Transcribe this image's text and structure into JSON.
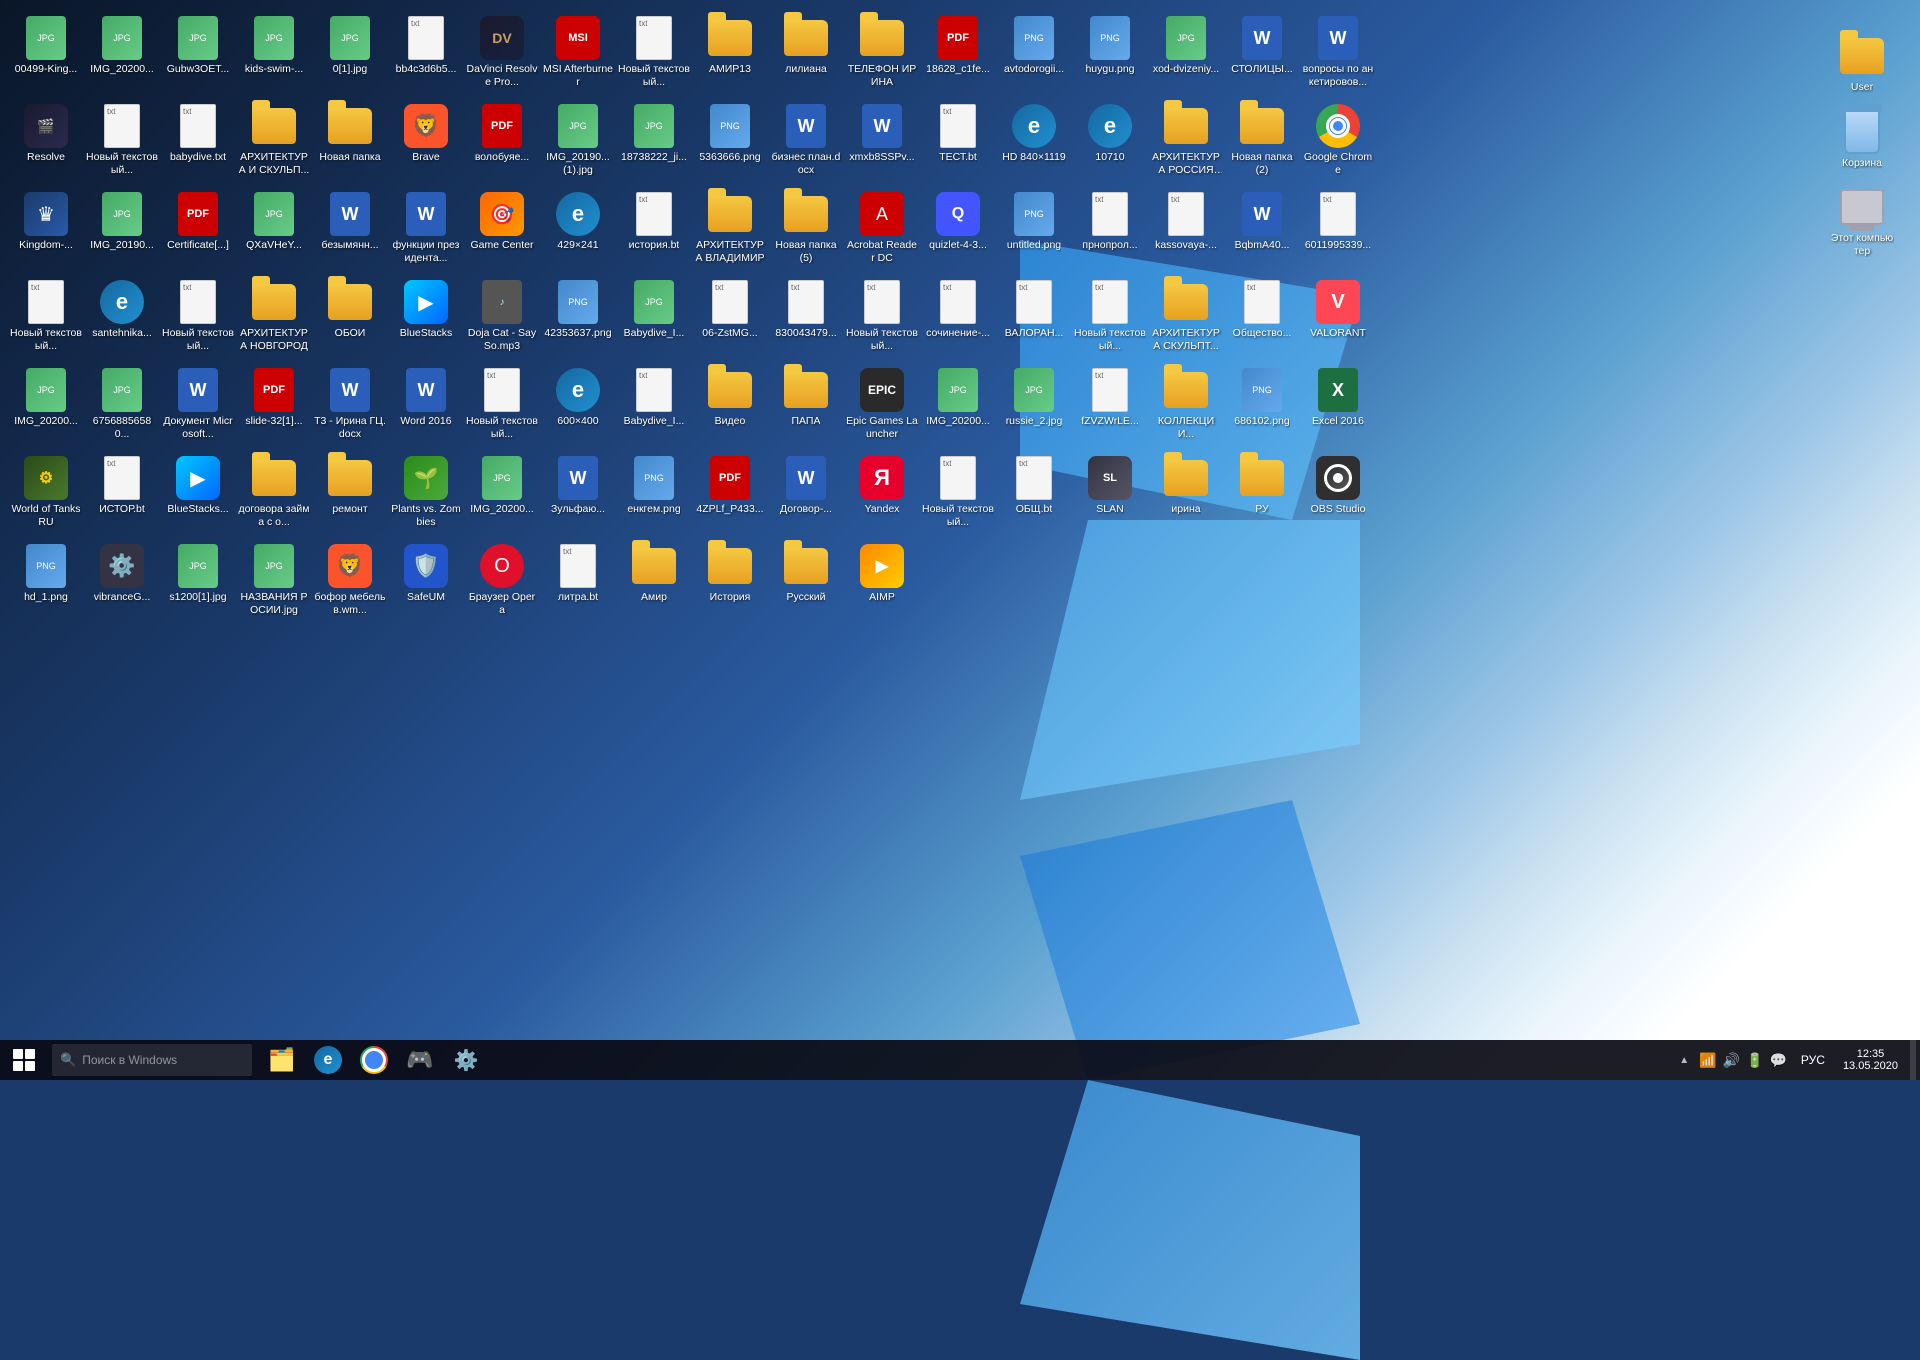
{
  "desktop": {
    "title": "Windows 10 Desktop",
    "icons": [
      {
        "id": "i1",
        "label": "00499-King...",
        "type": "jpg",
        "row": 1,
        "col": 1
      },
      {
        "id": "i2",
        "label": "IMG_20200...",
        "type": "jpg",
        "row": 1,
        "col": 2
      },
      {
        "id": "i3",
        "label": "Gubw3OET...",
        "type": "jpg",
        "row": 1,
        "col": 3
      },
      {
        "id": "i4",
        "label": "kids-swim-...",
        "type": "jpg",
        "row": 1,
        "col": 4
      },
      {
        "id": "i5",
        "label": "0[1].jpg",
        "type": "jpg",
        "row": 1,
        "col": 5
      },
      {
        "id": "i6",
        "label": "bb4c3d6b5...",
        "type": "txt",
        "row": 1,
        "col": 6
      },
      {
        "id": "i7",
        "label": "DaVinci Resolve Pro...",
        "type": "app-davinci",
        "row": 1,
        "col": 7
      },
      {
        "id": "i8",
        "label": "MSI Afterburner",
        "type": "app-msi",
        "row": 1,
        "col": 8
      },
      {
        "id": "i9",
        "label": "Новый текстовый...",
        "type": "txt",
        "row": 1,
        "col": 9
      },
      {
        "id": "i10",
        "label": "АМИР13",
        "type": "folder",
        "row": 1,
        "col": 10
      },
      {
        "id": "i11",
        "label": "лилиана",
        "type": "folder",
        "row": 1,
        "col": 11
      },
      {
        "id": "i12",
        "label": "ТЕЛЕФОН ИРИНА",
        "type": "folder",
        "row": 1,
        "col": 12
      },
      {
        "id": "i13",
        "label": "18628_c1fe...",
        "type": "pdf",
        "row": 2,
        "col": 1
      },
      {
        "id": "i14",
        "label": "avtodorogii...",
        "type": "png",
        "row": 2,
        "col": 2
      },
      {
        "id": "i15",
        "label": "huygu.png",
        "type": "png",
        "row": 2,
        "col": 3
      },
      {
        "id": "i16",
        "label": "xod-dvizeniy...",
        "type": "jpg",
        "row": 2,
        "col": 4
      },
      {
        "id": "i17",
        "label": "СТОЛИЦЫ...",
        "type": "word",
        "row": 2,
        "col": 5
      },
      {
        "id": "i18",
        "label": "вопросы по анкетировов...",
        "type": "word",
        "row": 2,
        "col": 6
      },
      {
        "id": "i19",
        "label": "Resolve",
        "type": "app-resolve",
        "row": 2,
        "col": 7
      },
      {
        "id": "i20",
        "label": "Новый текстовый...",
        "type": "txt",
        "row": 2,
        "col": 8
      },
      {
        "id": "i21",
        "label": "babydive.txt",
        "type": "txt",
        "row": 2,
        "col": 9
      },
      {
        "id": "i22",
        "label": "АРХИТЕКТУРА И СКУЛЬП...",
        "type": "folder",
        "row": 2,
        "col": 10
      },
      {
        "id": "i23",
        "label": "Новая папка",
        "type": "folder",
        "row": 2,
        "col": 11
      },
      {
        "id": "i24",
        "label": "Brave",
        "type": "app-brave",
        "row": 2,
        "col": 12
      },
      {
        "id": "i25",
        "label": "волобуяе...",
        "type": "pdf",
        "row": 3,
        "col": 1
      },
      {
        "id": "i26",
        "label": "IMG_20190...(1).jpg",
        "type": "jpg",
        "row": 3,
        "col": 2
      },
      {
        "id": "i27",
        "label": "18738222_ji...",
        "type": "jpg",
        "row": 3,
        "col": 3
      },
      {
        "id": "i28",
        "label": "5363666.png",
        "type": "png",
        "row": 3,
        "col": 4
      },
      {
        "id": "i29",
        "label": "бизнес план.docx",
        "type": "word",
        "row": 3,
        "col": 5
      },
      {
        "id": "i30",
        "label": "xmxb8SSPv...",
        "type": "word",
        "row": 3,
        "col": 6
      },
      {
        "id": "i31",
        "label": "ТЕСТ.bt",
        "type": "txt",
        "row": 3,
        "col": 7
      },
      {
        "id": "i32",
        "label": "HD 840×1119",
        "type": "app-ie",
        "row": 3,
        "col": 8
      },
      {
        "id": "i33",
        "label": "10710",
        "type": "app-ie",
        "row": 3,
        "col": 9
      },
      {
        "id": "i34",
        "label": "АРХИТЕКТУРА РОССИЯ И...",
        "type": "folder",
        "row": 3,
        "col": 10
      },
      {
        "id": "i35",
        "label": "Новая папка (2)",
        "type": "folder",
        "row": 3,
        "col": 11
      },
      {
        "id": "i36",
        "label": "Google Chrome",
        "type": "app-chrome",
        "row": 3,
        "col": 12
      },
      {
        "id": "i37",
        "label": "Kingdom-...",
        "type": "app-kingdom",
        "row": 4,
        "col": 1
      },
      {
        "id": "i38",
        "label": "IMG_20190...",
        "type": "jpg",
        "row": 4,
        "col": 2
      },
      {
        "id": "i39",
        "label": "Certificate[...]",
        "type": "pdf",
        "row": 4,
        "col": 3
      },
      {
        "id": "i40",
        "label": "QXaVHeY...",
        "type": "jpg",
        "row": 4,
        "col": 4
      },
      {
        "id": "i41",
        "label": "безымянн...",
        "type": "word",
        "row": 4,
        "col": 5
      },
      {
        "id": "i42",
        "label": "функции президента...",
        "type": "word",
        "row": 4,
        "col": 6
      },
      {
        "id": "i43",
        "label": "Game Center",
        "type": "app-gamecenter",
        "row": 4,
        "col": 7
      },
      {
        "id": "i44",
        "label": "429×241",
        "type": "app-ie",
        "row": 4,
        "col": 8
      },
      {
        "id": "i45",
        "label": "история.bt",
        "type": "txt",
        "row": 4,
        "col": 9
      },
      {
        "id": "i46",
        "label": "АРХИТЕКТУРА ВЛАДИМИР",
        "type": "folder",
        "row": 4,
        "col": 10
      },
      {
        "id": "i47",
        "label": "Новая папка (5)",
        "type": "folder",
        "row": 4,
        "col": 11
      },
      {
        "id": "i48",
        "label": "Acrobat Reader DC",
        "type": "app-acrobat",
        "row": 4,
        "col": 12
      },
      {
        "id": "i49",
        "label": "quizlet-4-3...",
        "type": "app-quizlet",
        "row": 5,
        "col": 1
      },
      {
        "id": "i50",
        "label": "untitled.png",
        "type": "png",
        "row": 5,
        "col": 2
      },
      {
        "id": "i51",
        "label": "прнопрол...",
        "type": "txt",
        "row": 5,
        "col": 3
      },
      {
        "id": "i52",
        "label": "kassovaya-...",
        "type": "txt",
        "row": 5,
        "col": 4
      },
      {
        "id": "i53",
        "label": "BqbmA40...",
        "type": "word",
        "row": 5,
        "col": 5
      },
      {
        "id": "i54",
        "label": "6011995339...",
        "type": "txt",
        "row": 5,
        "col": 6
      },
      {
        "id": "i55",
        "label": "Новый текстовый...",
        "type": "txt",
        "row": 5,
        "col": 7
      },
      {
        "id": "i56",
        "label": "santehnika...",
        "type": "app-ie",
        "row": 5,
        "col": 8
      },
      {
        "id": "i57",
        "label": "Новый текстовый...",
        "type": "txt",
        "row": 5,
        "col": 9
      },
      {
        "id": "i58",
        "label": "АРХИТЕКТУРА НОВГОРОД",
        "type": "folder",
        "row": 5,
        "col": 10
      },
      {
        "id": "i59",
        "label": "ОБОИ",
        "type": "folder",
        "row": 5,
        "col": 11
      },
      {
        "id": "i60",
        "label": "BlueStacks",
        "type": "app-bluestacks",
        "row": 5,
        "col": 12
      },
      {
        "id": "i61",
        "label": "Doja Cat - Say So.mp3",
        "type": "mp3",
        "row": 6,
        "col": 1
      },
      {
        "id": "i62",
        "label": "42353637.png",
        "type": "png",
        "row": 6,
        "col": 2
      },
      {
        "id": "i63",
        "label": "Babydive_I...",
        "type": "jpg",
        "row": 6,
        "col": 3
      },
      {
        "id": "i64",
        "label": "06-ZstMG...",
        "type": "txt",
        "row": 6,
        "col": 4
      },
      {
        "id": "i65",
        "label": "830043479...",
        "type": "txt",
        "row": 6,
        "col": 5
      },
      {
        "id": "i66",
        "label": "Новый текстовый...",
        "type": "txt",
        "row": 6,
        "col": 6
      },
      {
        "id": "i67",
        "label": "сочинение-...",
        "type": "txt",
        "row": 6,
        "col": 7
      },
      {
        "id": "i68",
        "label": "ВАЛОРАН...",
        "type": "txt",
        "row": 6,
        "col": 8
      },
      {
        "id": "i69",
        "label": "Новый текстовый...",
        "type": "txt",
        "row": 6,
        "col": 9
      },
      {
        "id": "i70",
        "label": "АРХИТЕКТУРА СКУЛЬПТ...",
        "type": "folder",
        "row": 6,
        "col": 10
      },
      {
        "id": "i71",
        "label": "Общество...",
        "type": "txt",
        "row": 6,
        "col": 11
      },
      {
        "id": "i72",
        "label": "VALORANT",
        "type": "app-valorant",
        "row": 6,
        "col": 12
      },
      {
        "id": "i73",
        "label": "IMG_20200...",
        "type": "jpg",
        "row": 7,
        "col": 1
      },
      {
        "id": "i74",
        "label": "67568856580...",
        "type": "jpg",
        "row": 7,
        "col": 2
      },
      {
        "id": "i75",
        "label": "Документ Microsoft...",
        "type": "word",
        "row": 7,
        "col": 3
      },
      {
        "id": "i76",
        "label": "slide-32[1]...",
        "type": "pdf",
        "row": 7,
        "col": 4
      },
      {
        "id": "i77",
        "label": "Т3 - Ирина ГЦ.docx",
        "type": "word",
        "row": 7,
        "col": 5
      },
      {
        "id": "i78",
        "label": "Word 2016",
        "type": "word",
        "row": 7,
        "col": 6
      },
      {
        "id": "i79",
        "label": "Новый текстовый...",
        "type": "txt",
        "row": 7,
        "col": 7
      },
      {
        "id": "i80",
        "label": "600×400",
        "type": "app-ie",
        "row": 7,
        "col": 8
      },
      {
        "id": "i81",
        "label": "Babydive_I...",
        "type": "txt",
        "row": 7,
        "col": 9
      },
      {
        "id": "i82",
        "label": "Видео",
        "type": "folder",
        "row": 7,
        "col": 10
      },
      {
        "id": "i83",
        "label": "ПАПА",
        "type": "folder",
        "row": 7,
        "col": 11
      },
      {
        "id": "i84",
        "label": "Epic Games Launcher",
        "type": "app-epic",
        "row": 7,
        "col": 12
      },
      {
        "id": "i85",
        "label": "IMG_20200...",
        "type": "jpg",
        "row": 8,
        "col": 1
      },
      {
        "id": "i86",
        "label": "russie_2.jpg",
        "type": "jpg",
        "row": 8,
        "col": 2
      },
      {
        "id": "i87",
        "label": "fZVZWrLE...",
        "type": "txt",
        "row": 8,
        "col": 3
      },
      {
        "id": "i88",
        "label": "КОЛЛЕКЦИИ...",
        "type": "folder",
        "row": 8,
        "col": 4
      },
      {
        "id": "i89",
        "label": "686102.png",
        "type": "png",
        "row": 8,
        "col": 5
      },
      {
        "id": "i90",
        "label": "Excel 2016",
        "type": "excel",
        "row": 8,
        "col": 6
      },
      {
        "id": "i91",
        "label": "World of Tanks RU",
        "type": "app-wot",
        "row": 8,
        "col": 7
      },
      {
        "id": "i92",
        "label": "ИСТОР.bt",
        "type": "txt",
        "row": 8,
        "col": 8
      },
      {
        "id": "i93",
        "label": "BlueStacks...",
        "type": "app-bluestacks",
        "row": 8,
        "col": 9
      },
      {
        "id": "i94",
        "label": "договора займа с о...",
        "type": "folder",
        "row": 8,
        "col": 10
      },
      {
        "id": "i95",
        "label": "ремонт",
        "type": "folder",
        "row": 8,
        "col": 11
      },
      {
        "id": "i96",
        "label": "Plants vs. Zombies",
        "type": "app-pvz",
        "row": 8,
        "col": 12
      },
      {
        "id": "i97",
        "label": "IMG_20200...",
        "type": "jpg",
        "row": 9,
        "col": 1
      },
      {
        "id": "i98",
        "label": "Зульфаю...",
        "type": "word",
        "row": 9,
        "col": 2
      },
      {
        "id": "i99",
        "label": "енкгем.png",
        "type": "png",
        "row": 9,
        "col": 3
      },
      {
        "id": "i100",
        "label": "4ZPLf_P433...",
        "type": "pdf",
        "row": 9,
        "col": 4
      },
      {
        "id": "i101",
        "label": "Договор-...",
        "type": "word",
        "row": 9,
        "col": 5
      },
      {
        "id": "i102",
        "label": "Yandex",
        "type": "app-yandex",
        "row": 9,
        "col": 6
      },
      {
        "id": "i103",
        "label": "Новый текстовый...",
        "type": "txt",
        "row": 9,
        "col": 7
      },
      {
        "id": "i104",
        "label": "ОБЩ.bt",
        "type": "txt",
        "row": 9,
        "col": 8
      },
      {
        "id": "i105",
        "label": "SLAN",
        "type": "app-slan",
        "row": 9,
        "col": 9
      },
      {
        "id": "i106",
        "label": "ирина",
        "type": "folder",
        "row": 9,
        "col": 10
      },
      {
        "id": "i107",
        "label": "РУ",
        "type": "folder",
        "row": 9,
        "col": 11
      },
      {
        "id": "i108",
        "label": "OBS Studio",
        "type": "app-obs",
        "row": 9,
        "col": 12
      },
      {
        "id": "i109",
        "label": "hd_1.png",
        "type": "png",
        "row": 10,
        "col": 1
      },
      {
        "id": "i110",
        "label": "vibranceG...",
        "type": "app-gear",
        "row": 10,
        "col": 2
      },
      {
        "id": "i111",
        "label": "s1200[1].jpg",
        "type": "jpg",
        "row": 10,
        "col": 3
      },
      {
        "id": "i112",
        "label": "НАЗВАНИЯ РОСИИ.jpg",
        "type": "jpg",
        "row": 10,
        "col": 4
      },
      {
        "id": "i113",
        "label": "бoфор мебельв.wm...",
        "type": "app-brave",
        "row": 10,
        "col": 5
      },
      {
        "id": "i114",
        "label": "SafeUM",
        "type": "app-safeup",
        "row": 10,
        "col": 6
      },
      {
        "id": "i115",
        "label": "Браузер Opera",
        "type": "app-opera",
        "row": 10,
        "col": 7
      },
      {
        "id": "i116",
        "label": "литра.bt",
        "type": "txt",
        "row": 10,
        "col": 8
      },
      {
        "id": "i117",
        "label": "Амир",
        "type": "folder",
        "row": 10,
        "col": 9
      },
      {
        "id": "i118",
        "label": "История",
        "type": "folder",
        "row": 10,
        "col": 10
      },
      {
        "id": "i119",
        "label": "Русский",
        "type": "folder",
        "row": 10,
        "col": 11
      },
      {
        "id": "i120",
        "label": "AIMP",
        "type": "app-aimp",
        "row": 10,
        "col": 12
      }
    ],
    "right_icons": [
      {
        "id": "user",
        "label": "User",
        "type": "user-folder"
      },
      {
        "id": "trash",
        "label": "Корзина",
        "type": "trash"
      },
      {
        "id": "pc",
        "label": "Этот компьютер",
        "type": "pc"
      }
    ]
  },
  "taskbar": {
    "search_placeholder": "Поиск в Windows",
    "clock_time": "12:35",
    "clock_date": "13.05.2020",
    "language": "РУС",
    "apps": [
      {
        "id": "tb-ie",
        "label": "Edge",
        "type": "edge"
      },
      {
        "id": "tb-cortana",
        "label": "Cortana",
        "type": "cortana"
      },
      {
        "id": "tb-steam",
        "label": "Steam",
        "type": "steam"
      },
      {
        "id": "tb-settings",
        "label": "Settings",
        "type": "settings"
      }
    ]
  }
}
